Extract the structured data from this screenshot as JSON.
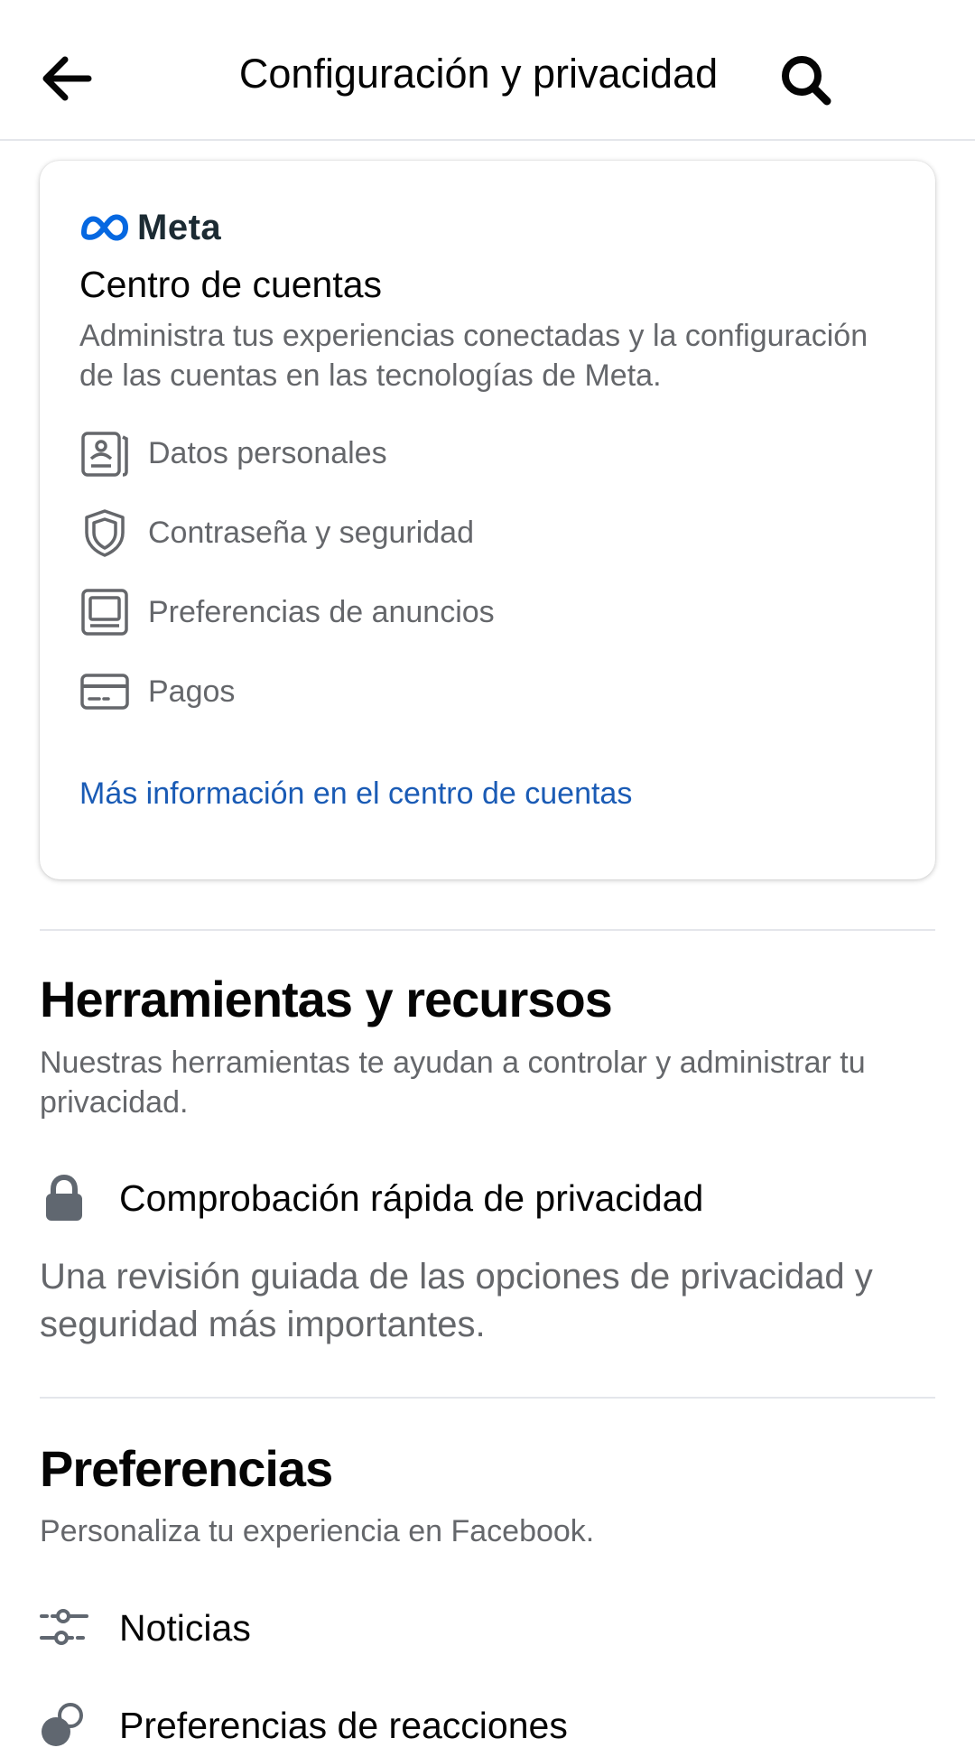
{
  "header": {
    "title": "Configuración y privacidad",
    "back_icon": "arrow-left-icon",
    "search_icon": "search-icon"
  },
  "accounts_center": {
    "brand": "Meta",
    "title": "Centro de cuentas",
    "description": "Administra tus experiencias conectadas y la configuración de las cuentas en las tecnologías de Meta.",
    "items": [
      {
        "label": "Datos personales",
        "icon": "id-card-icon"
      },
      {
        "label": "Contraseña y seguridad",
        "icon": "shield-icon"
      },
      {
        "label": "Preferencias de anuncios",
        "icon": "monitor-icon"
      },
      {
        "label": "Pagos",
        "icon": "credit-card-icon"
      }
    ],
    "link": "Más información en el centro de cuentas"
  },
  "tools": {
    "title": "Herramientas y recursos",
    "description": "Nuestras herramientas te ayudan a controlar y administrar tu privacidad.",
    "privacy_check": {
      "label": "Comprobación rápida de privacidad",
      "description": "Una revisión guiada de las opciones de privacidad y seguridad más importantes.",
      "icon": "lock-icon"
    }
  },
  "preferences": {
    "title": "Preferencias",
    "description": "Personaliza tu experiencia en Facebook.",
    "items": [
      {
        "label": "Noticias",
        "icon": "sliders-icon"
      },
      {
        "label": "Preferencias de reacciones",
        "icon": "reactions-icon"
      }
    ]
  },
  "colors": {
    "link": "#1a5bb5",
    "secondary_text": "#65676b",
    "meta_blue": "#0668e1"
  }
}
